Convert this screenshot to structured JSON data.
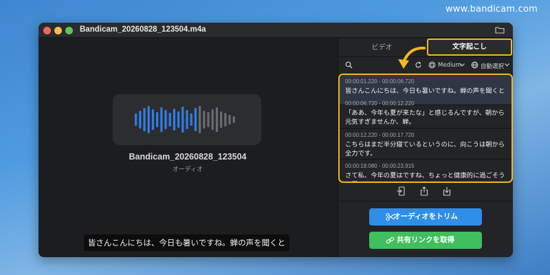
{
  "watermark": "www.bandicam.com",
  "window": {
    "title": "Bandicam_20260828_123504.m4a"
  },
  "player": {
    "filename": "Bandicam_20260828_123504",
    "media_type": "オーディオ",
    "caption": "皆さんこんにちは、今日も暑いですね。蝉の声を聞くと"
  },
  "tabs": {
    "video": "ビデオ",
    "transcription": "文字起こし"
  },
  "toolbar": {
    "model": "Medium",
    "language": "自動選択"
  },
  "segments": [
    {
      "time": "00:00:01.220 - 00:00:06.720",
      "text": "皆さんこんにちは、今日も暑いですね。蝉の声を聞くと"
    },
    {
      "time": "00:00:06.720 - 00:00:12.220",
      "text": "「ああ、今年も夏が来たな」と感じるんですが、朝から元気すぎませんか、蝉。"
    },
    {
      "time": "00:00:12.220 - 00:00:17.720",
      "text": "こちらはまだ半分寝ているというのに、向こうは朝から全力です。"
    },
    {
      "time": "00:00:18.080 - 00:00:23.915",
      "text": "さて私、今年の夏はですね、ちょっと健康的に過ごそうと思いまして"
    }
  ],
  "buttons": {
    "trim": "オーディオをトリム",
    "share": "共有リンクを取得"
  },
  "colors": {
    "highlight": "#f2b81f",
    "trim_button": "#2f8ee8",
    "share_button": "#3fbf5d",
    "wave_played": "#2f7ee6",
    "wave_unplayed": "#6a6b70"
  }
}
